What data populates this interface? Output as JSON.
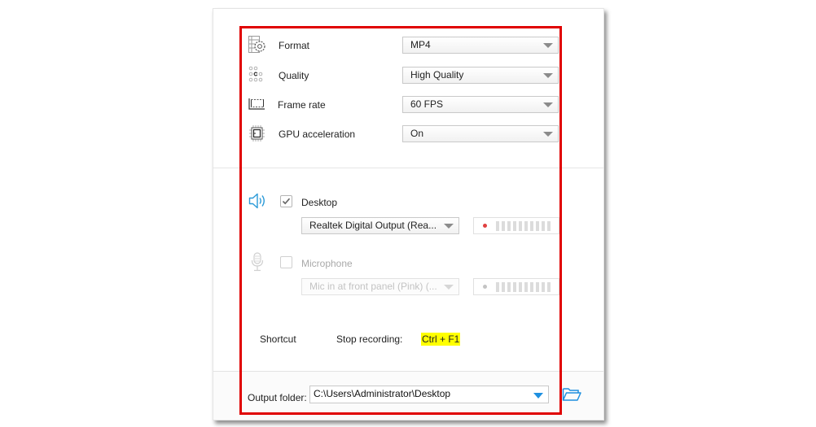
{
  "video_settings": {
    "rows": [
      {
        "icon": "format-gear-icon",
        "label": "Format",
        "value": "MP4"
      },
      {
        "icon": "quality-dots-icon",
        "label": "Quality",
        "value": "High Quality"
      },
      {
        "icon": "frame-rate-icon",
        "label": "Frame rate",
        "value": "60 FPS"
      },
      {
        "icon": "gpu-chip-icon",
        "label": "GPU acceleration",
        "value": "On"
      }
    ]
  },
  "audio": {
    "desktop": {
      "icon": "speaker-icon",
      "label": "Desktop",
      "checked": true,
      "device": "Realtek Digital Output (Rea...",
      "meter_dot_color": "#e04040",
      "meter_bars": 10
    },
    "microphone": {
      "icon": "microphone-icon",
      "label": "Microphone",
      "checked": false,
      "device": "Mic in at front panel (Pink) (...",
      "meter_dot_color": "#c4c4c4",
      "meter_bars": 10
    }
  },
  "shortcut": {
    "label": "Shortcut",
    "action": "Stop recording:",
    "keys": "Ctrl + F1",
    "key_highlight": "#ffff00"
  },
  "output": {
    "label": "Output folder:",
    "path": "C:\\Users\\Administrator\\Desktop"
  },
  "colors": {
    "accent_blue": "#1e90e0",
    "highlight_red": "#e00000"
  }
}
